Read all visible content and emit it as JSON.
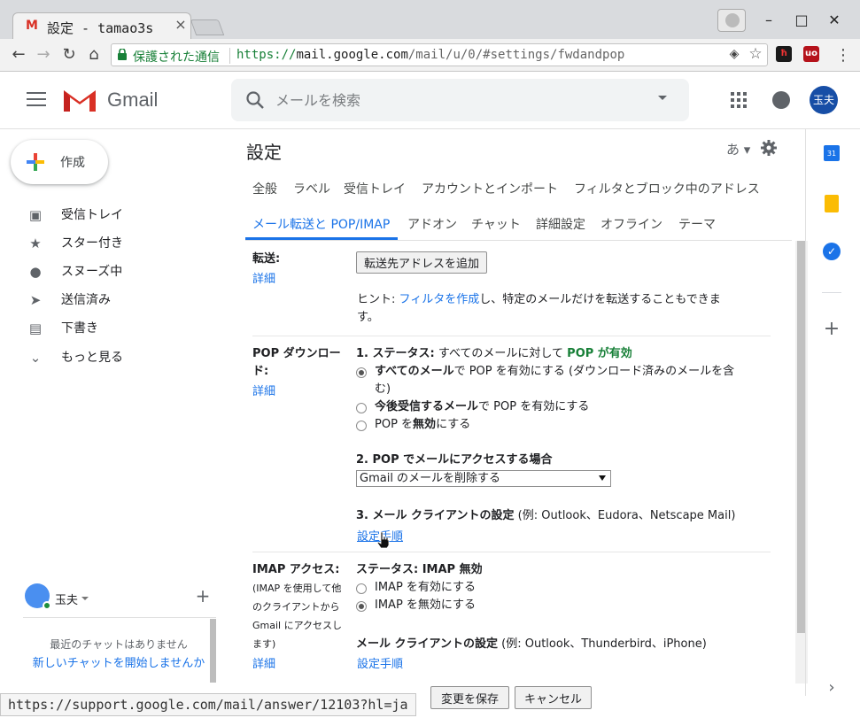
{
  "browser": {
    "tab_title": "設定 - tamao3s",
    "secure_label": "保護された通信",
    "url_scheme": "https://",
    "url_host": "mail.google.com",
    "url_path": "/mail/u/0/#settings/fwdandpop",
    "status_url": "https://support.google.com/mail/answer/12103?hl=ja"
  },
  "header": {
    "app_name": "Gmail",
    "search_placeholder": "メールを検索",
    "avatar_initials": "玉夫"
  },
  "sidebar": {
    "compose_label": "作成",
    "items": [
      {
        "label": "受信トレイ",
        "icon": "inbox-icon"
      },
      {
        "label": "スター付き",
        "icon": "star-icon"
      },
      {
        "label": "スヌーズ中",
        "icon": "clock-icon"
      },
      {
        "label": "送信済み",
        "icon": "send-icon"
      },
      {
        "label": "下書き",
        "icon": "draft-icon"
      },
      {
        "label": "もっと見る",
        "icon": "chevron-down-icon"
      }
    ],
    "chat_user": "玉夫",
    "chat_empty": "最近のチャットはありません",
    "chat_start": "新しいチャットを開始しませんか"
  },
  "settings": {
    "title": "設定",
    "lang_label": "あ",
    "tabs_row1": [
      "全般",
      "ラベル",
      "受信トレイ",
      "アカウントとインポート",
      "フィルタとブロック中のアドレス"
    ],
    "tabs_row2": [
      "メール転送と POP/IMAP",
      "アドオン",
      "チャット",
      "詳細設定",
      "オフライン",
      "テーマ"
    ],
    "forwarding": {
      "label": "転送:",
      "details": "詳細",
      "add_button": "転送先アドレスを追加",
      "hint_prefix": "ヒント: ",
      "hint_link": "フィルタを作成",
      "hint_rest": "し、特定のメールだけを転送することもできま",
      "hint_wrap": "す。"
    },
    "pop": {
      "label_line1": "POP ダウンロー",
      "label_line2": "ド:",
      "details": "詳細",
      "status_heading": "1. ステータス:",
      "status_text": " すべてのメールに対して ",
      "status_value": "POP が有効",
      "opt1_bold": "すべてのメール",
      "opt1_rest": "で POP を有効にする (ダウンロード済みのメールを含",
      "opt1_wrap": "む)",
      "opt2_bold": "今後受信するメール",
      "opt2_rest": "で POP を有効にする",
      "opt3_pre": "POP を",
      "opt3_bold": "無効",
      "opt3_post": "にする",
      "access_heading": "2. POP でメールにアクセスする場合",
      "access_select": "Gmail のメールを削除する",
      "client_heading": "3. メール クライアントの設定",
      "client_examples": " (例: Outlook、Eudora、Netscape Mail)",
      "client_link": "設定手順"
    },
    "imap": {
      "label": "IMAP アクセス:",
      "desc": [
        "(IMAP を使用して他",
        "のクライアントから",
        "Gmail にアクセスし",
        "ます)"
      ],
      "details": "詳細",
      "status": "ステータス: IMAP 無効",
      "opt_enable": "IMAP を有効にする",
      "opt_disable": "IMAP を無効にする",
      "client_heading": "メール クライアントの設定",
      "client_examples": " (例: Outlook、Thunderbird、iPhone)",
      "client_link": "設定手順"
    },
    "save_button": "変更を保存",
    "cancel_button": "キャンセル"
  },
  "colors": {
    "accent": "#1a73e8",
    "status_green": "#188038",
    "gmail_red": "#d93025"
  }
}
